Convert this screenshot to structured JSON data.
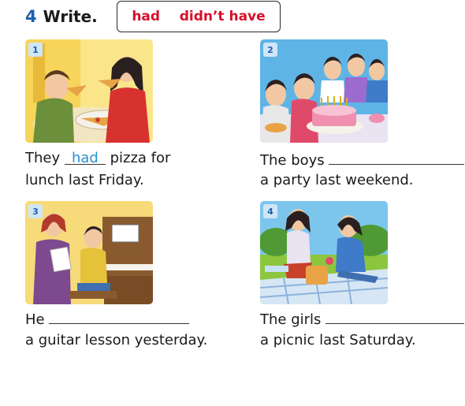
{
  "exercise": {
    "number": "4",
    "title": "Write."
  },
  "word_box": {
    "words": [
      "had",
      "didn’t have"
    ]
  },
  "items": [
    {
      "number": "1",
      "before": "They",
      "answer": "had",
      "after": "pizza for",
      "line2": "lunch last Friday."
    },
    {
      "number": "2",
      "before": "The boys",
      "answer": "",
      "after": "",
      "line2": "a party last weekend."
    },
    {
      "number": "3",
      "before": "He",
      "answer": "",
      "after": "",
      "line2": "a guitar lesson yesterday."
    },
    {
      "number": "4",
      "before": "The girls",
      "answer": "",
      "after": "",
      "line2": "a picnic last Saturday."
    }
  ],
  "colors": {
    "accent_blue": "#1c5fae",
    "word_red": "#d7102a",
    "answer_blue": "#2a8fd4"
  }
}
